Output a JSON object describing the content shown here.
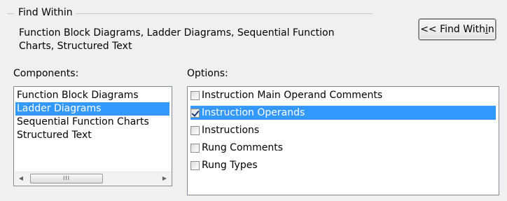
{
  "find_within": {
    "title": "Find Within",
    "summary": "Function Block Diagrams, Ladder Diagrams, Sequential Function Charts, Structured Text",
    "button_label_prefix": "<< Find With",
    "button_label_mnemonic": "i",
    "button_label_suffix": "n"
  },
  "components": {
    "label": "Components:",
    "items": [
      {
        "label": "Function Block Diagrams",
        "selected": false
      },
      {
        "label": "Ladder Diagrams",
        "selected": true
      },
      {
        "label": "Sequential Function Charts",
        "selected": false
      },
      {
        "label": "Structured Text",
        "selected": false
      }
    ],
    "scrollbar": {
      "left_arrow": "◀",
      "right_arrow": "▶",
      "grip": "III"
    }
  },
  "options": {
    "label": "Options:",
    "items": [
      {
        "label": "Instruction Main Operand Comments",
        "checked": false,
        "selected": false
      },
      {
        "label": "Instruction Operands",
        "checked": true,
        "selected": true
      },
      {
        "label": "Instructions",
        "checked": false,
        "selected": false
      },
      {
        "label": "Rung Comments",
        "checked": false,
        "selected": false
      },
      {
        "label": "Rung Types",
        "checked": false,
        "selected": false
      }
    ]
  },
  "colors": {
    "selection": "#3399ff",
    "background": "#f0f0f0"
  }
}
